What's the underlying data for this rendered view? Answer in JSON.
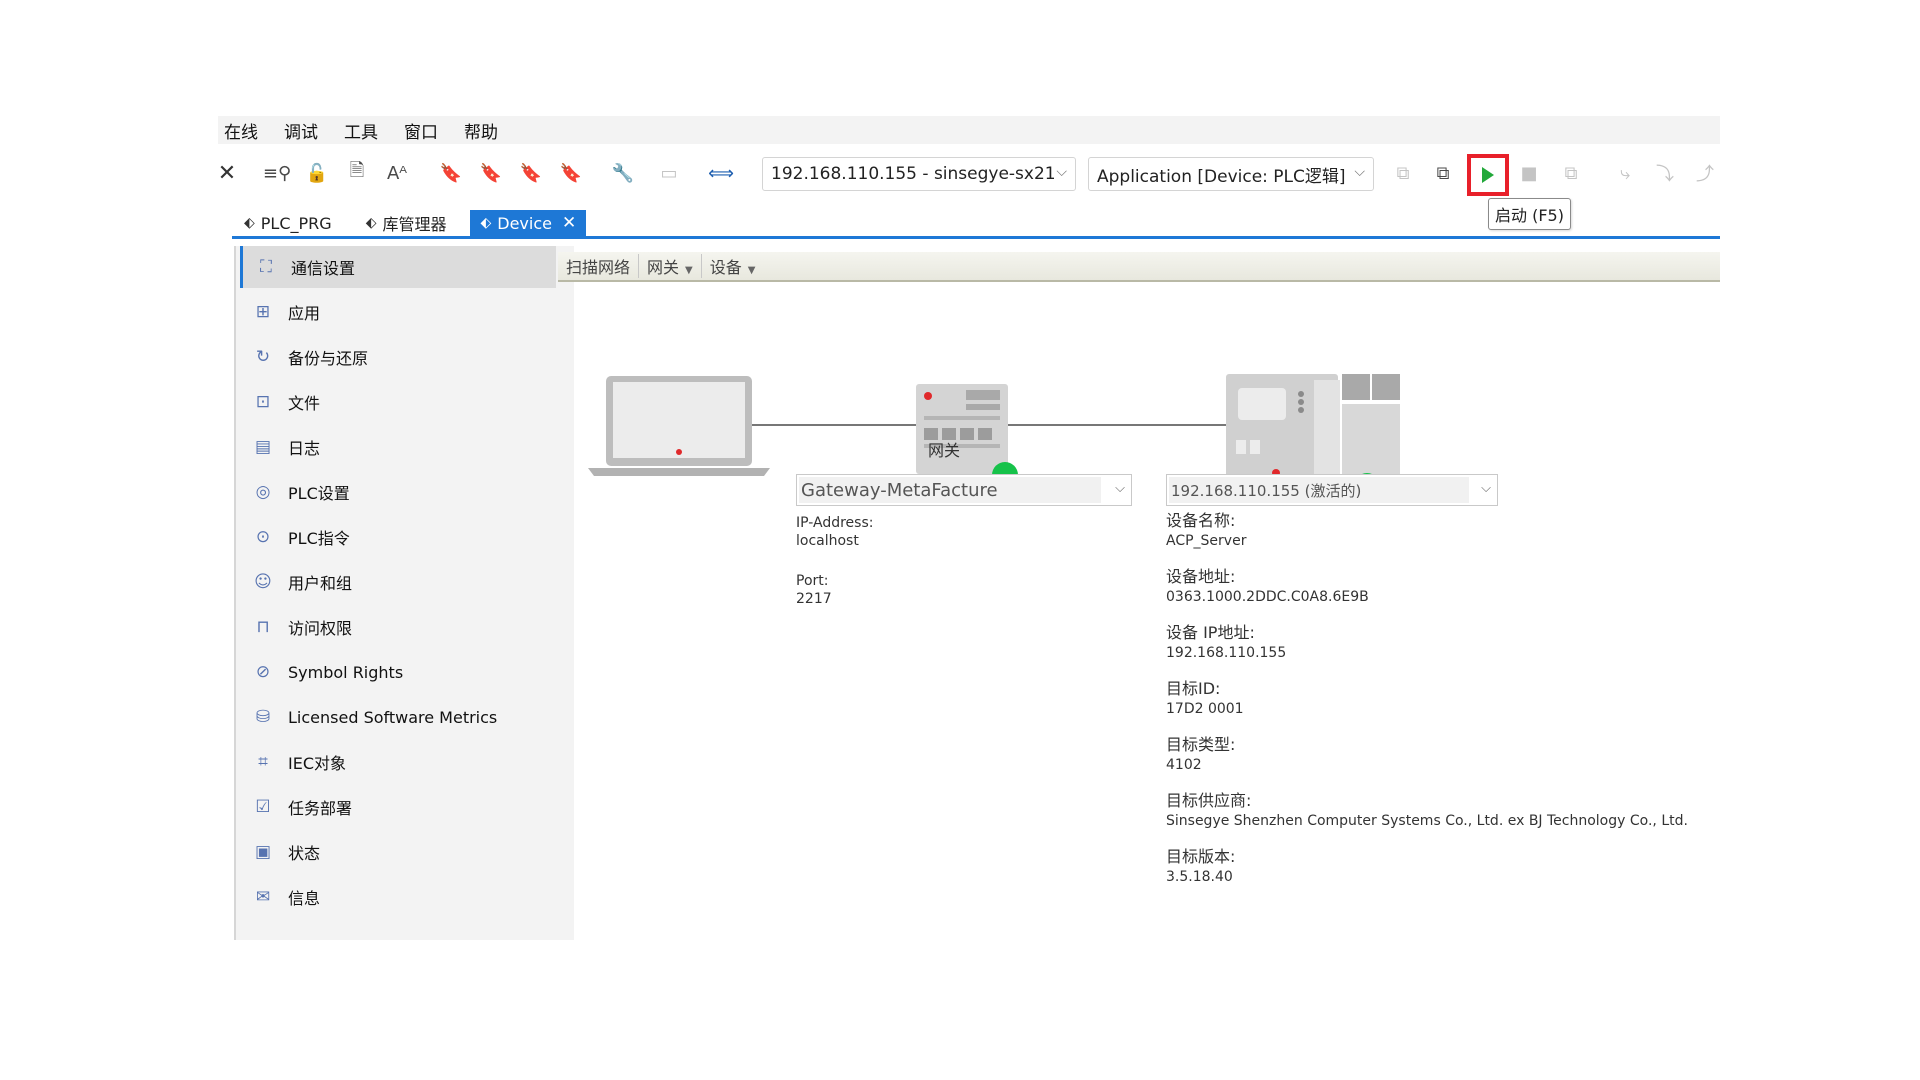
{
  "menubar": {
    "items": [
      "在线",
      "调试",
      "工具",
      "窗口",
      "帮助"
    ]
  },
  "toolbar": {
    "close_icon": "close-icon",
    "device_combo": "192.168.110.155 - sinsegye-sx21",
    "app_combo": "Application [Device: PLC逻辑]",
    "run_tooltip": "启动 (F5)",
    "run_color": "#22a83a",
    "highlight_color": "#e8202a"
  },
  "tabs": [
    {
      "label": "PLC_PRG",
      "active": false
    },
    {
      "label": "库管理器",
      "active": false
    },
    {
      "label": "Device",
      "active": true
    }
  ],
  "sidebar": {
    "items": [
      {
        "label": "通信设置",
        "icon": "network-icon"
      },
      {
        "label": "应用",
        "icon": "apps-icon"
      },
      {
        "label": "备份与还原",
        "icon": "backup-icon"
      },
      {
        "label": "文件",
        "icon": "file-icon"
      },
      {
        "label": "日志",
        "icon": "log-icon"
      },
      {
        "label": "PLC设置",
        "icon": "plc-settings-icon"
      },
      {
        "label": "PLC指令",
        "icon": "plc-command-icon"
      },
      {
        "label": "用户和组",
        "icon": "users-icon"
      },
      {
        "label": "访问权限",
        "icon": "lock-icon"
      },
      {
        "label": "Symbol Rights",
        "icon": "symbol-rights-icon"
      },
      {
        "label": "Licensed Software Metrics",
        "icon": "database-icon"
      },
      {
        "label": "IEC对象",
        "icon": "iec-object-icon"
      },
      {
        "label": "任务部署",
        "icon": "task-icon"
      },
      {
        "label": "状态",
        "icon": "status-icon"
      },
      {
        "label": "信息",
        "icon": "mail-icon"
      }
    ]
  },
  "subbar": {
    "items": [
      "扫描网络",
      "网关",
      "设备"
    ]
  },
  "gateway": {
    "label": "网关",
    "select": "Gateway-MetaFacture",
    "ip_label": "IP-Address:",
    "ip_value": "localhost",
    "port_label": "Port:",
    "port_value": "2217"
  },
  "device": {
    "select": "192.168.110.155 (激活的)",
    "fields": [
      {
        "label": "设备名称:",
        "value": "ACP_Server"
      },
      {
        "label": "设备地址:",
        "value": "0363.1000.2DDC.C0A8.6E9B"
      },
      {
        "label": "设备 IP地址:",
        "value": "192.168.110.155"
      },
      {
        "label": "目标ID:",
        "value": "17D2 0001"
      },
      {
        "label": "目标类型:",
        "value": "4102"
      },
      {
        "label": "目标供应商:",
        "value": "Sinsegye Shenzhen Computer Systems Co., Ltd. ex BJ Technology Co., Ltd."
      },
      {
        "label": "目标版本:",
        "value": "3.5.18.40"
      }
    ],
    "status_color": "#16c24a"
  }
}
